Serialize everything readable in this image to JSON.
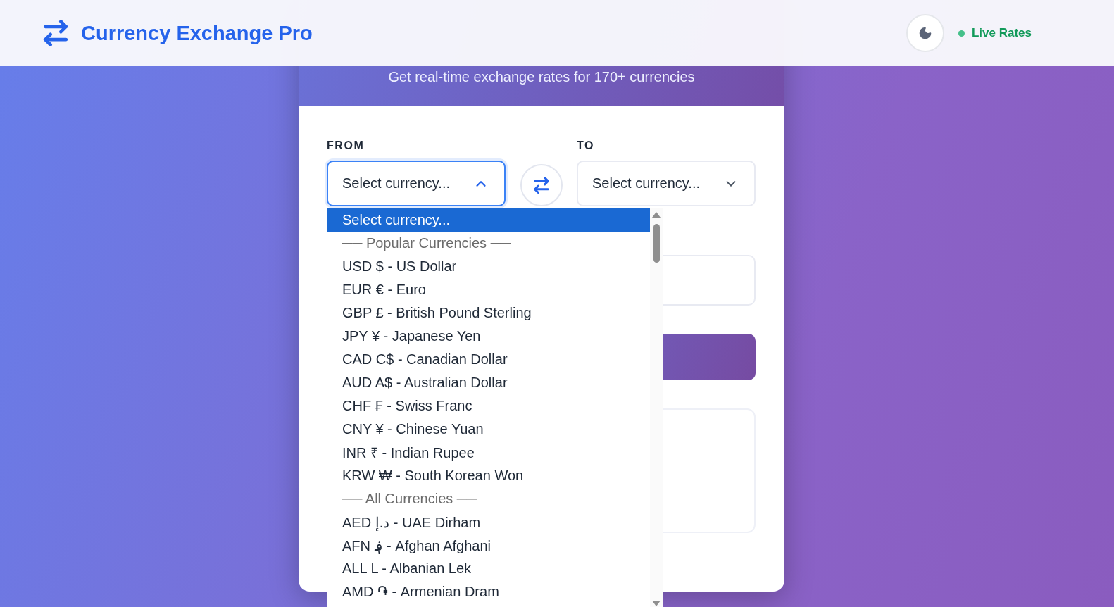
{
  "header": {
    "title": "Currency Exchange Pro",
    "status": "Live Rates",
    "dark_mode": false
  },
  "hero": {
    "subtitle": "Get real-time exchange rates for 170+ currencies"
  },
  "converter": {
    "from": {
      "label": "FROM",
      "value": "Select currency...",
      "expanded": true
    },
    "to": {
      "label": "TO",
      "value": "Select currency...",
      "expanded": false
    },
    "from_options": [
      {
        "kind": "option",
        "label": "Select currency...",
        "selected": true
      },
      {
        "kind": "group",
        "label": "── Popular Currencies ──",
        "selected": false
      },
      {
        "kind": "option",
        "label": "USD $ - US Dollar",
        "selected": false
      },
      {
        "kind": "option",
        "label": "EUR € - Euro",
        "selected": false
      },
      {
        "kind": "option",
        "label": "GBP £ - British Pound Sterling",
        "selected": false
      },
      {
        "kind": "option",
        "label": "JPY ¥ - Japanese Yen",
        "selected": false
      },
      {
        "kind": "option",
        "label": "CAD C$ - Canadian Dollar",
        "selected": false
      },
      {
        "kind": "option",
        "label": "AUD A$ - Australian Dollar",
        "selected": false
      },
      {
        "kind": "option",
        "label": "CHF ₣ - Swiss Franc",
        "selected": false
      },
      {
        "kind": "option",
        "label": "CNY ¥ - Chinese Yuan",
        "selected": false
      },
      {
        "kind": "option",
        "label": "INR ₹ - Indian Rupee",
        "selected": false
      },
      {
        "kind": "option",
        "label": "KRW ₩ - South Korean Won",
        "selected": false
      },
      {
        "kind": "group",
        "label": "── All Currencies ──",
        "selected": false
      },
      {
        "kind": "option",
        "label": "AED د.إ - UAE Dirham",
        "selected": false
      },
      {
        "kind": "option",
        "label": "AFN ؋ - Afghan Afghani",
        "selected": false
      },
      {
        "kind": "option",
        "label": "ALL L - Albanian Lek",
        "selected": false
      },
      {
        "kind": "option",
        "label": "AMD ֏ - Armenian Dram",
        "selected": false
      }
    ]
  }
}
